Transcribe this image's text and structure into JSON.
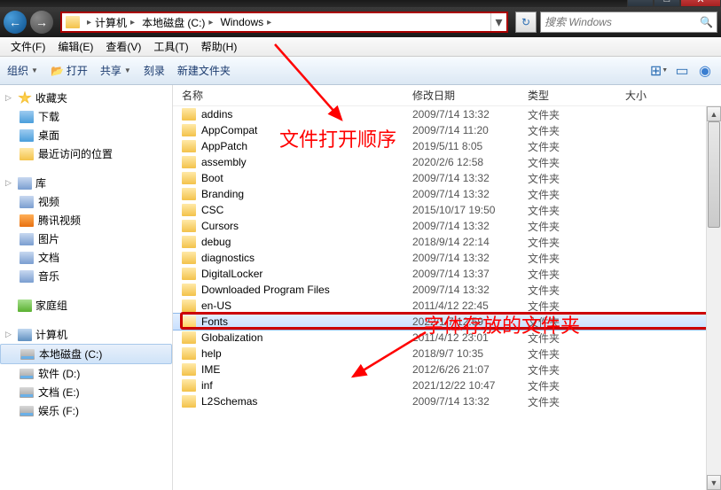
{
  "window_buttons": {
    "min": "—",
    "max": "□",
    "close": "✕"
  },
  "breadcrumb": [
    "计算机",
    "本地磁盘 (C:)",
    "Windows"
  ],
  "search": {
    "placeholder": "搜索 Windows"
  },
  "menu": [
    "文件(F)",
    "编辑(E)",
    "查看(V)",
    "工具(T)",
    "帮助(H)"
  ],
  "toolbar": {
    "organize": "组织",
    "open": "打开",
    "share": "共享",
    "burn": "刻录",
    "newfolder": "新建文件夹"
  },
  "sidebar": {
    "favorites": {
      "label": "收藏夹",
      "items": [
        "下载",
        "桌面",
        "最近访问的位置"
      ]
    },
    "libraries": {
      "label": "库",
      "items": [
        "视频",
        "腾讯视频",
        "图片",
        "文档",
        "音乐"
      ]
    },
    "homegroup": {
      "label": "家庭组"
    },
    "computer": {
      "label": "计算机",
      "items": [
        "本地磁盘 (C:)",
        "软件 (D:)",
        "文档 (E:)",
        "娱乐 (F:)"
      ]
    }
  },
  "columns": {
    "name": "名称",
    "date": "修改日期",
    "type": "类型",
    "size": "大小"
  },
  "type_folder": "文件夹",
  "files": [
    {
      "name": "addins",
      "date": "2009/7/14 13:32"
    },
    {
      "name": "AppCompat",
      "date": "2009/7/14 11:20"
    },
    {
      "name": "AppPatch",
      "date": "2019/5/11 8:05"
    },
    {
      "name": "assembly",
      "date": "2020/2/6 12:58"
    },
    {
      "name": "Boot",
      "date": "2009/7/14 13:32"
    },
    {
      "name": "Branding",
      "date": "2009/7/14 13:32"
    },
    {
      "name": "CSC",
      "date": "2015/10/17 19:50"
    },
    {
      "name": "Cursors",
      "date": "2009/7/14 13:32"
    },
    {
      "name": "debug",
      "date": "2018/9/14 22:14"
    },
    {
      "name": "diagnostics",
      "date": "2009/7/14 13:32"
    },
    {
      "name": "DigitalLocker",
      "date": "2009/7/14 13:37"
    },
    {
      "name": "Downloaded Program Files",
      "date": "2009/7/14 13:32"
    },
    {
      "name": "en-US",
      "date": "2011/4/12 22:45"
    },
    {
      "name": "Fonts",
      "date": "2022/1/7 12:59",
      "selected": true
    },
    {
      "name": "Globalization",
      "date": "2011/4/12 23:01"
    },
    {
      "name": "help",
      "date": "2018/9/7 10:35"
    },
    {
      "name": "IME",
      "date": "2012/6/26 21:07"
    },
    {
      "name": "inf",
      "date": "2021/12/22 10:47"
    },
    {
      "name": "L2Schemas",
      "date": "2009/7/14 13:32"
    }
  ],
  "annotations": {
    "a1": "文件打开顺序",
    "a2": "字体存放的文件夹"
  }
}
